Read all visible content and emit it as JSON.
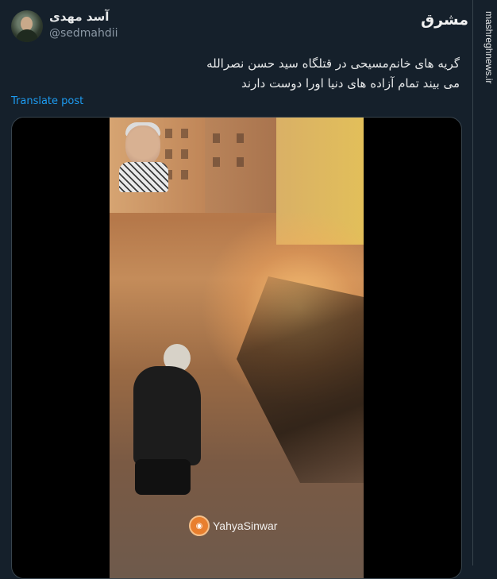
{
  "author": {
    "display_name": "آسد مهدی",
    "handle": "@sedmahdii"
  },
  "tweet": {
    "lines": [
      "گریه های خانم‌مسیحی در قتلگاه سید حسن نصرالله",
      "می بیند تمام آزاده های دنیا اورا دوست دارند"
    ],
    "translate_label": "Translate post"
  },
  "media": {
    "watermark": "YahyaSinwar"
  },
  "branding": {
    "logo_text": "مشرق",
    "site_url": "mashreghnews.ir"
  },
  "colors": {
    "background": "#15202b",
    "link": "#1d9bf0",
    "secondary_text": "#8b98a5"
  }
}
